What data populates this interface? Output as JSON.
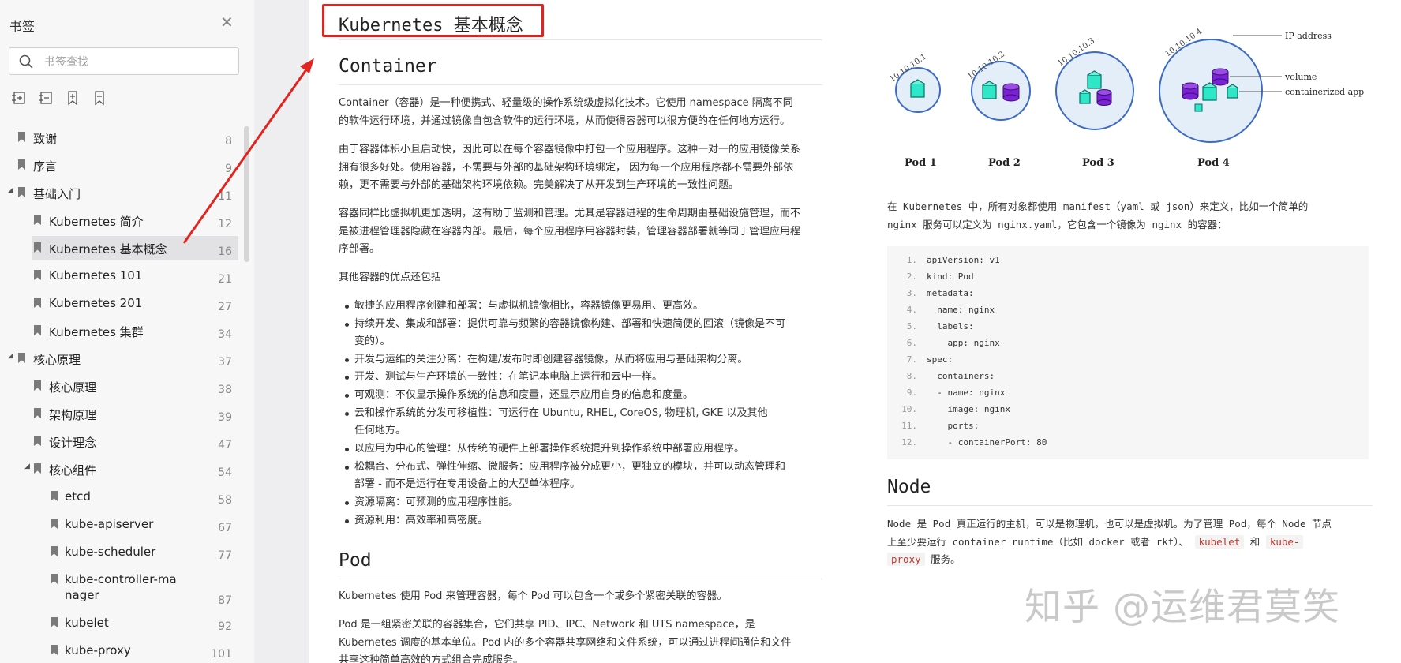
{
  "sidebar": {
    "title": "书签",
    "search_placeholder": "书签查找",
    "tool_icons": [
      "expand-all-icon",
      "collapse-all-icon",
      "add-bookmark-icon",
      "remove-bookmark-icon"
    ],
    "items": [
      {
        "label": "致谢",
        "page": "8"
      },
      {
        "label": "序言",
        "page": "9"
      },
      {
        "label": "基础入门",
        "page": "11"
      },
      {
        "label": "Kubernetes 简介",
        "page": "12"
      },
      {
        "label": "Kubernetes 基本概念",
        "page": "16"
      },
      {
        "label": "Kubernetes 101",
        "page": "21"
      },
      {
        "label": "Kubernetes 201",
        "page": "27"
      },
      {
        "label": "Kubernetes 集群",
        "page": "34"
      },
      {
        "label": "核心原理",
        "page": "37"
      },
      {
        "label": "核心原理",
        "page": "38"
      },
      {
        "label": "架构原理",
        "page": "39"
      },
      {
        "label": "设计理念",
        "page": "47"
      },
      {
        "label": "核心组件",
        "page": "54"
      },
      {
        "label": "etcd",
        "page": "58"
      },
      {
        "label": "kube-apiserver",
        "page": "67"
      },
      {
        "label": "kube-scheduler",
        "page": "77"
      },
      {
        "label": "kube-controller-ma",
        "label2": "nager",
        "page": "87"
      },
      {
        "label": "kubelet",
        "page": "92"
      },
      {
        "label": "kube-proxy",
        "page": "101"
      }
    ]
  },
  "doc": {
    "title": "Kubernetes 基本概念",
    "container_heading": "Container",
    "p1a": "Container（容器）是一种便携式、轻量级的操作系统级虚拟化技术。它使用 namespace 隔离不同",
    "p1b": "的软件运行环境，并通过镜像自包含软件的运行环境，从而使得容器可以很方便的在任何地方运行。",
    "p2a": "由于容器体积小且启动快，因此可以在每个容器镜像中打包一个应用程序。这种一对一的应用镜像关系",
    "p2b": "拥有很多好处。使用容器，不需要与外部的基础架构环境绑定， 因为每一个应用程序都不需要外部依",
    "p2c": "赖，更不需要与外部的基础架构环境依赖。完美解决了从开发到生产环境的一致性问题。",
    "p3a": "容器同样比虚拟机更加透明，这有助于监测和管理。尤其是容器进程的生命周期由基础设施管理，而不",
    "p3b": "是被进程管理器隐藏在容器内部。最后，每个应用程序用容器封装，管理容器部署就等同于管理应用程",
    "p3c": "序部署。",
    "p4": "其他容器的优点还包括",
    "bullets": [
      "敏捷的应用程序创建和部署：与虚拟机镜像相比，容器镜像更易用、更高效。",
      "持续开发、集成和部署：提供可靠与频繁的容器镜像构建、部署和快速简便的回滚（镜像是不可",
      "变的）。",
      "开发与运维的关注分离：在构建/发布时即创建容器镜像，从而将应用与基础架构分离。",
      "开发、测试与生产环境的一致性：在笔记本电脑上运行和云中一样。",
      "可观测：不仅显示操作系统的信息和度量，还显示应用自身的信息和度量。",
      "云和操作系统的分发可移植性：可运行在 Ubuntu, RHEL, CoreOS, 物理机, GKE 以及其他",
      "任何地方。",
      "以应用为中心的管理：从传统的硬件上部署操作系统提升到操作系统中部署应用程序。",
      "松耦合、分布式、弹性伸缩、微服务：应用程序被分成更小，更独立的模块，并可以动态管理和",
      "部署 - 而不是运行在专用设备上的大型单体程序。",
      "资源隔离：可预测的应用程序性能。",
      "资源利用：高效率和高密度。"
    ],
    "pod_heading": "Pod",
    "pod_p1": "Kubernetes 使用 Pod 来管理容器，每个 Pod 可以包含一个或多个紧密关联的容器。",
    "pod_p2a": "Pod 是一组紧密关联的容器集合，它们共享 PID、IPC、Network 和 UTS namespace，是",
    "pod_p2b": "Kubernetes 调度的基本单位。Pod 内的多个容器共享网络和文件系统，可以通过进程间通信和文件",
    "pod_p2c": "共享这种简单高效的方式组合完成服务。"
  },
  "figure": {
    "ip_label": "IP address",
    "volume_label": "volume",
    "app_label": "containerized app",
    "pods": [
      {
        "name": "Pod 1",
        "ip": "10.10.10.1"
      },
      {
        "name": "Pod 2",
        "ip": "10.10.10.2"
      },
      {
        "name": "Pod 3",
        "ip": "10.10.10.3"
      },
      {
        "name": "Pod 4",
        "ip": "10.10.10.4"
      }
    ]
  },
  "right": {
    "manifest_a": "在 Kubernetes 中，所有对象都使用 manifest（yaml 或 json）来定义，比如一个简单的",
    "manifest_b": "nginx 服务可以定义为 nginx.yaml，它包含一个镜像为 nginx 的容器：",
    "code": [
      {
        "n": "1.",
        "t": "apiVersion: v1"
      },
      {
        "n": "2.",
        "t": "kind: Pod"
      },
      {
        "n": "3.",
        "t": "metadata:"
      },
      {
        "n": "4.",
        "t": "  name: nginx"
      },
      {
        "n": "5.",
        "t": "  labels:"
      },
      {
        "n": "6.",
        "t": "    app: nginx"
      },
      {
        "n": "7.",
        "t": "spec:"
      },
      {
        "n": "8.",
        "t": "  containers:"
      },
      {
        "n": "9.",
        "t": "  - name: nginx"
      },
      {
        "n": "10.",
        "t": "    image: nginx"
      },
      {
        "n": "11.",
        "t": "    ports:"
      },
      {
        "n": "12.",
        "t": "    - containerPort: 80"
      }
    ],
    "node_heading": "Node",
    "node_a": "Node 是 Pod 真正运行的主机，可以是物理机，也可以是虚拟机。为了管理 Pod，每个 Node 节点",
    "node_b1": "上至少要运行 container runtime（比如 docker 或者 rkt）、",
    "node_b_kubelet": "kubelet",
    "node_b_and": "和",
    "node_b_kp1": "kube-",
    "node_c_kp2": "proxy",
    "node_c": "服务。"
  },
  "watermark": "知乎 @运维君莫笑",
  "colors": {
    "highlight": "#e12420",
    "teal": "#2ee6c8",
    "purple": "#7b22d6",
    "circle": "#3d6bc2"
  }
}
